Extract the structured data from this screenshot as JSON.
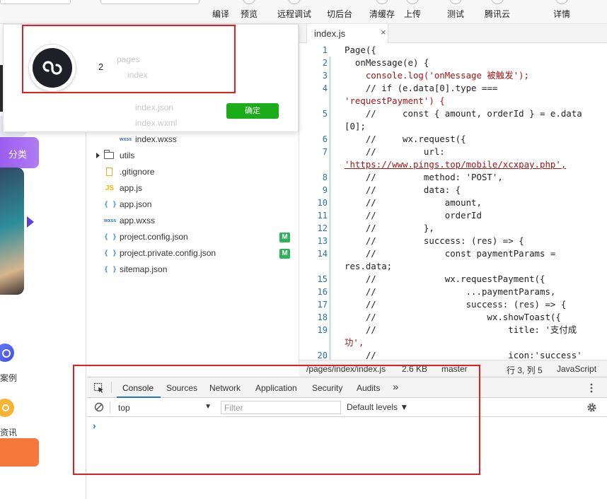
{
  "toolbar": {
    "buttons": [
      {
        "label": "编译"
      },
      {
        "label": "预览"
      },
      {
        "label": "远程调试"
      },
      {
        "label": "切后台"
      },
      {
        "label": "清缓存"
      },
      {
        "label": "上传"
      },
      {
        "label": "测试"
      },
      {
        "label": "腾讯云"
      },
      {
        "label": "详情"
      }
    ]
  },
  "simulator": {
    "category_label": "分类",
    "case_label": "案例",
    "news_label": "资讯"
  },
  "dialog": {
    "message": "2",
    "ok_label": "确定",
    "ghost_folders": [
      "pages",
      "index"
    ],
    "ghost_files": [
      "index.json",
      "index.wxml"
    ]
  },
  "explorer": {
    "items": [
      {
        "name": "index.wxss",
        "icon": "wxss"
      },
      {
        "name": "utils",
        "icon": "folder"
      },
      {
        "name": ".gitignore",
        "icon": "git"
      },
      {
        "name": "app.js",
        "icon": "js"
      },
      {
        "name": "app.json",
        "icon": "json"
      },
      {
        "name": "app.wxss",
        "icon": "wxss"
      },
      {
        "name": "project.config.json",
        "icon": "json",
        "badge": "M"
      },
      {
        "name": "project.private.config.json",
        "icon": "json",
        "badge": "M"
      },
      {
        "name": "sitemap.json",
        "icon": "json"
      }
    ],
    "icon_labels": {
      "js": "JS",
      "json": "{ }",
      "wxss": "wxss"
    }
  },
  "editor": {
    "tab_name": "index.js",
    "tab_close": "×",
    "lines": [
      {
        "n": "1",
        "t": "Page({"
      },
      {
        "n": "2",
        "t": "  onMessage(e) {"
      },
      {
        "n": "3",
        "t": "    console.log('onMessage 被触发');"
      },
      {
        "n": "4",
        "t": "    // if (e.data[0].type ==="
      },
      {
        "n": "",
        "t": "'requestPayment') {"
      },
      {
        "n": "5",
        "t": "    //     const { amount, orderId } = e.data"
      },
      {
        "n": "",
        "t": "[0];"
      },
      {
        "n": "6",
        "t": "    //     wx.request({"
      },
      {
        "n": "7",
        "t": "    //         url:"
      },
      {
        "n": "",
        "t": "'https://www.pings.top/mobile/xcxpay.php',"
      },
      {
        "n": "8",
        "t": "    //         method: 'POST',"
      },
      {
        "n": "9",
        "t": "    //         data: {"
      },
      {
        "n": "10",
        "t": "    //             amount,"
      },
      {
        "n": "11",
        "t": "    //             orderId"
      },
      {
        "n": "12",
        "t": "    //         },"
      },
      {
        "n": "13",
        "t": "    //         success: (res) => {"
      },
      {
        "n": "14",
        "t": "    //             const paymentParams ="
      },
      {
        "n": "",
        "t": "res.data;"
      },
      {
        "n": "15",
        "t": "    //             wx.requestPayment({"
      },
      {
        "n": "16",
        "t": "    //                 ...paymentParams,"
      },
      {
        "n": "17",
        "t": "    //                 success: (res) => {"
      },
      {
        "n": "18",
        "t": "    //                     wx.showToast({"
      },
      {
        "n": "19",
        "t": "    //                         title: '支付成"
      },
      {
        "n": "",
        "t": "功',"
      },
      {
        "n": "20",
        "t": "    //                         icon:'success'"
      }
    ]
  },
  "status_bar": {
    "path": "/pages/index/index.js",
    "size": "2.6 KB",
    "branch": "master",
    "position": "行 3, 列 5",
    "language": "JavaScript"
  },
  "devtools": {
    "tabs": [
      "Console",
      "Sources",
      "Network",
      "Application",
      "Security",
      "Audits"
    ],
    "more": "»",
    "context": "top",
    "filter_placeholder": "Filter",
    "levels": "Default levels ▼",
    "prompt": "›"
  }
}
